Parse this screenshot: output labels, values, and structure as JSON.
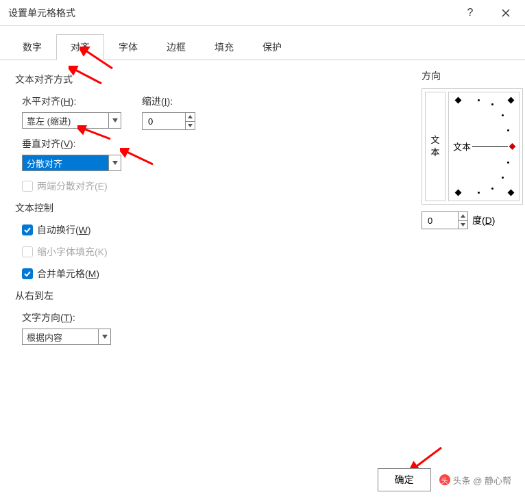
{
  "title": "设置单元格格式",
  "titlebar": {
    "help": "?",
    "close": "×"
  },
  "tabs": [
    "数字",
    "对齐",
    "字体",
    "边框",
    "填充",
    "保护"
  ],
  "alignment": {
    "section_label": "文本对齐方式",
    "h_label_pre": "水平对齐(",
    "h_label_u": "H",
    "h_label_post": "):",
    "h_value": "靠左 (缩进)",
    "indent_label_pre": "缩进(",
    "indent_label_u": "I",
    "indent_label_post": "):",
    "indent_value": "0",
    "v_label_pre": "垂直对齐(",
    "v_label_u": "V",
    "v_label_post": "):",
    "v_value": "分散对齐",
    "justify_label": "两端分散对齐(E)"
  },
  "text_control": {
    "section_label": "文本控制",
    "wrap_pre": "自动换行(",
    "wrap_u": "W",
    "wrap_post": ")",
    "shrink_label": "缩小字体填充(K)",
    "merge_pre": "合并单元格(",
    "merge_u": "M",
    "merge_post": ")"
  },
  "rtl": {
    "section_label": "从右到左",
    "dir_label_pre": "文字方向(",
    "dir_label_u": "T",
    "dir_label_post": "):",
    "dir_value": "根据内容"
  },
  "orientation": {
    "section_label": "方向",
    "vert_text_1": "文",
    "vert_text_2": "本",
    "dial_text": "文本",
    "degree_value": "0",
    "degree_label_pre": "度(",
    "degree_label_u": "D",
    "degree_label_post": ")"
  },
  "buttons": {
    "ok": "确定"
  },
  "watermark": {
    "text": "头条 @ 静心帮"
  }
}
